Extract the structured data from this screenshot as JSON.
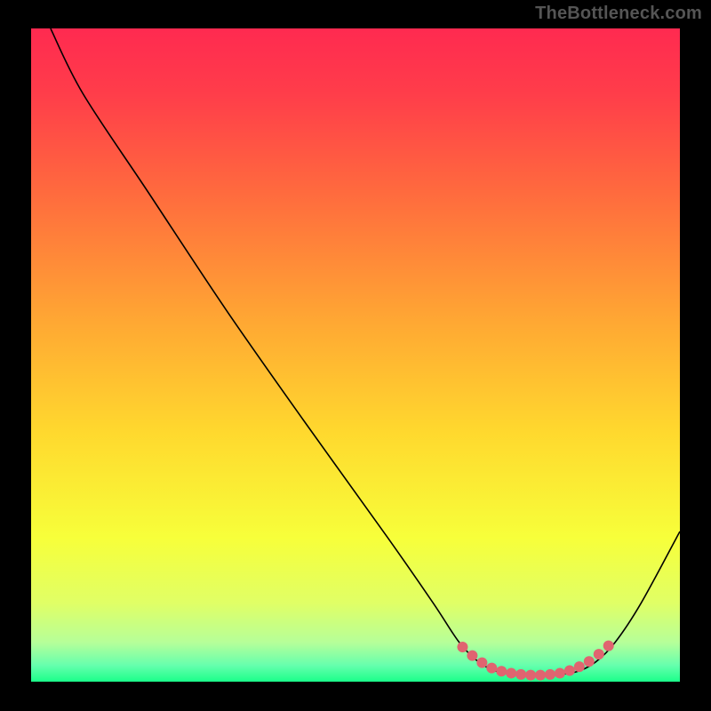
{
  "watermark": "TheBottleneck.com",
  "chart_data": {
    "type": "line",
    "title": "",
    "xlabel": "",
    "ylabel": "",
    "xlim": [
      0,
      100
    ],
    "ylim": [
      0,
      100
    ],
    "background_gradient": {
      "stops": [
        {
          "offset": 0.0,
          "color": "#ff2a50"
        },
        {
          "offset": 0.1,
          "color": "#ff3d4a"
        },
        {
          "offset": 0.25,
          "color": "#ff6a3e"
        },
        {
          "offset": 0.45,
          "color": "#ffa833"
        },
        {
          "offset": 0.62,
          "color": "#ffd92e"
        },
        {
          "offset": 0.78,
          "color": "#f7ff3a"
        },
        {
          "offset": 0.88,
          "color": "#e0ff66"
        },
        {
          "offset": 0.94,
          "color": "#b6ff99"
        },
        {
          "offset": 0.975,
          "color": "#66ffad"
        },
        {
          "offset": 1.0,
          "color": "#1bff8a"
        }
      ]
    },
    "series": [
      {
        "name": "bottleneck-curve",
        "color": "#000000",
        "width": 1.6,
        "points": [
          {
            "x": 3,
            "y": 100
          },
          {
            "x": 8,
            "y": 90
          },
          {
            "x": 18,
            "y": 75
          },
          {
            "x": 30,
            "y": 57
          },
          {
            "x": 42,
            "y": 40
          },
          {
            "x": 55,
            "y": 22
          },
          {
            "x": 62,
            "y": 12
          },
          {
            "x": 66,
            "y": 6
          },
          {
            "x": 69,
            "y": 3
          },
          {
            "x": 72,
            "y": 1.5
          },
          {
            "x": 76,
            "y": 1
          },
          {
            "x": 80,
            "y": 1
          },
          {
            "x": 84,
            "y": 1.5
          },
          {
            "x": 87,
            "y": 3
          },
          {
            "x": 90,
            "y": 6
          },
          {
            "x": 94,
            "y": 12
          },
          {
            "x": 100,
            "y": 23
          }
        ]
      }
    ],
    "highlight": {
      "name": "optimal-region",
      "color": "#e06470",
      "radius": 6,
      "points": [
        {
          "x": 66.5,
          "y": 5.3
        },
        {
          "x": 68.0,
          "y": 4.0
        },
        {
          "x": 69.5,
          "y": 2.9
        },
        {
          "x": 71.0,
          "y": 2.1
        },
        {
          "x": 72.5,
          "y": 1.6
        },
        {
          "x": 74.0,
          "y": 1.3
        },
        {
          "x": 75.5,
          "y": 1.1
        },
        {
          "x": 77.0,
          "y": 1.0
        },
        {
          "x": 78.5,
          "y": 1.0
        },
        {
          "x": 80.0,
          "y": 1.1
        },
        {
          "x": 81.5,
          "y": 1.3
        },
        {
          "x": 83.0,
          "y": 1.7
        },
        {
          "x": 84.5,
          "y": 2.3
        },
        {
          "x": 86.0,
          "y": 3.1
        },
        {
          "x": 87.5,
          "y": 4.2
        },
        {
          "x": 89.0,
          "y": 5.5
        }
      ]
    }
  }
}
